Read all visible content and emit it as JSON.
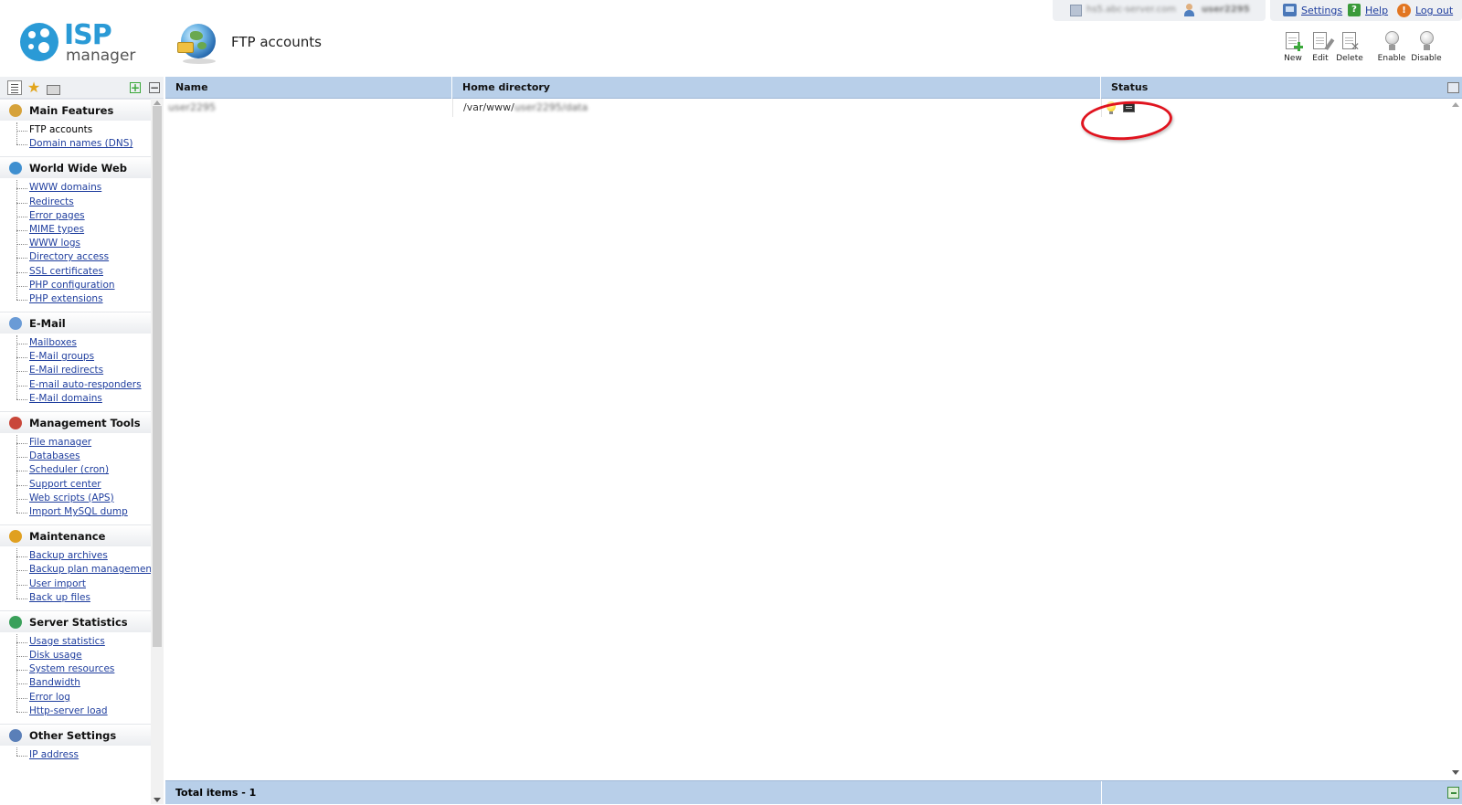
{
  "app": {
    "logo_line1": "ISP",
    "logo_line2": "manager"
  },
  "page": {
    "title": "FTP accounts"
  },
  "session": {
    "server": "hs5.abc-server.com",
    "user": "user2295"
  },
  "top_links": {
    "settings": "Settings",
    "help": "Help",
    "help_glyph": "?",
    "logout": "Log out",
    "logout_glyph": "!"
  },
  "toolbar": {
    "new": "New",
    "edit": "Edit",
    "delete": "Delete",
    "enable": "Enable",
    "disable": "Disable"
  },
  "sidebar": {
    "groups": [
      {
        "title": "Main Features",
        "icon": "home-globe-icon",
        "items": [
          "FTP accounts",
          "Domain names (DNS)"
        ]
      },
      {
        "title": "World Wide Web",
        "icon": "globe-icon",
        "items": [
          "WWW domains",
          "Redirects",
          "Error pages",
          "MIME types",
          "WWW logs",
          "Directory access",
          "SSL certificates",
          "PHP configuration",
          "PHP extensions"
        ]
      },
      {
        "title": "E-Mail",
        "icon": "mail-icon",
        "items": [
          "Mailboxes",
          "E-Mail groups",
          "E-Mail redirects",
          "E-mail auto-responders",
          "E-Mail domains"
        ]
      },
      {
        "title": "Management Tools",
        "icon": "tools-icon",
        "items": [
          "File manager",
          "Databases",
          "Scheduler (cron)",
          "Support center",
          "Web scripts (APS)",
          "Import MySQL dump"
        ]
      },
      {
        "title": "Maintenance",
        "icon": "maintenance-icon",
        "items": [
          "Backup archives",
          "Backup plan management",
          "User import",
          "Back up files"
        ]
      },
      {
        "title": "Server Statistics",
        "icon": "statistics-icon",
        "items": [
          "Usage statistics",
          "Disk usage",
          "System resources",
          "Bandwidth",
          "Error log",
          "Http-server load"
        ]
      },
      {
        "title": "Other Settings",
        "icon": "settings-icon",
        "items": [
          "IP address"
        ]
      }
    ]
  },
  "grid": {
    "columns": [
      "Name",
      "Home directory",
      "Status"
    ],
    "rows": [
      {
        "name": "user2295",
        "home_prefix": "/var/www/",
        "home_rest": "user2295/data",
        "status": [
          "enabled-bulb-icon",
          "ssh-icon"
        ]
      }
    ],
    "footer": "Total items - 1"
  },
  "colors": {
    "accent": "#2a9ad6",
    "grid_header": "#b8cfe9",
    "link": "#1f3e9e",
    "highlight": "#e0141f"
  }
}
